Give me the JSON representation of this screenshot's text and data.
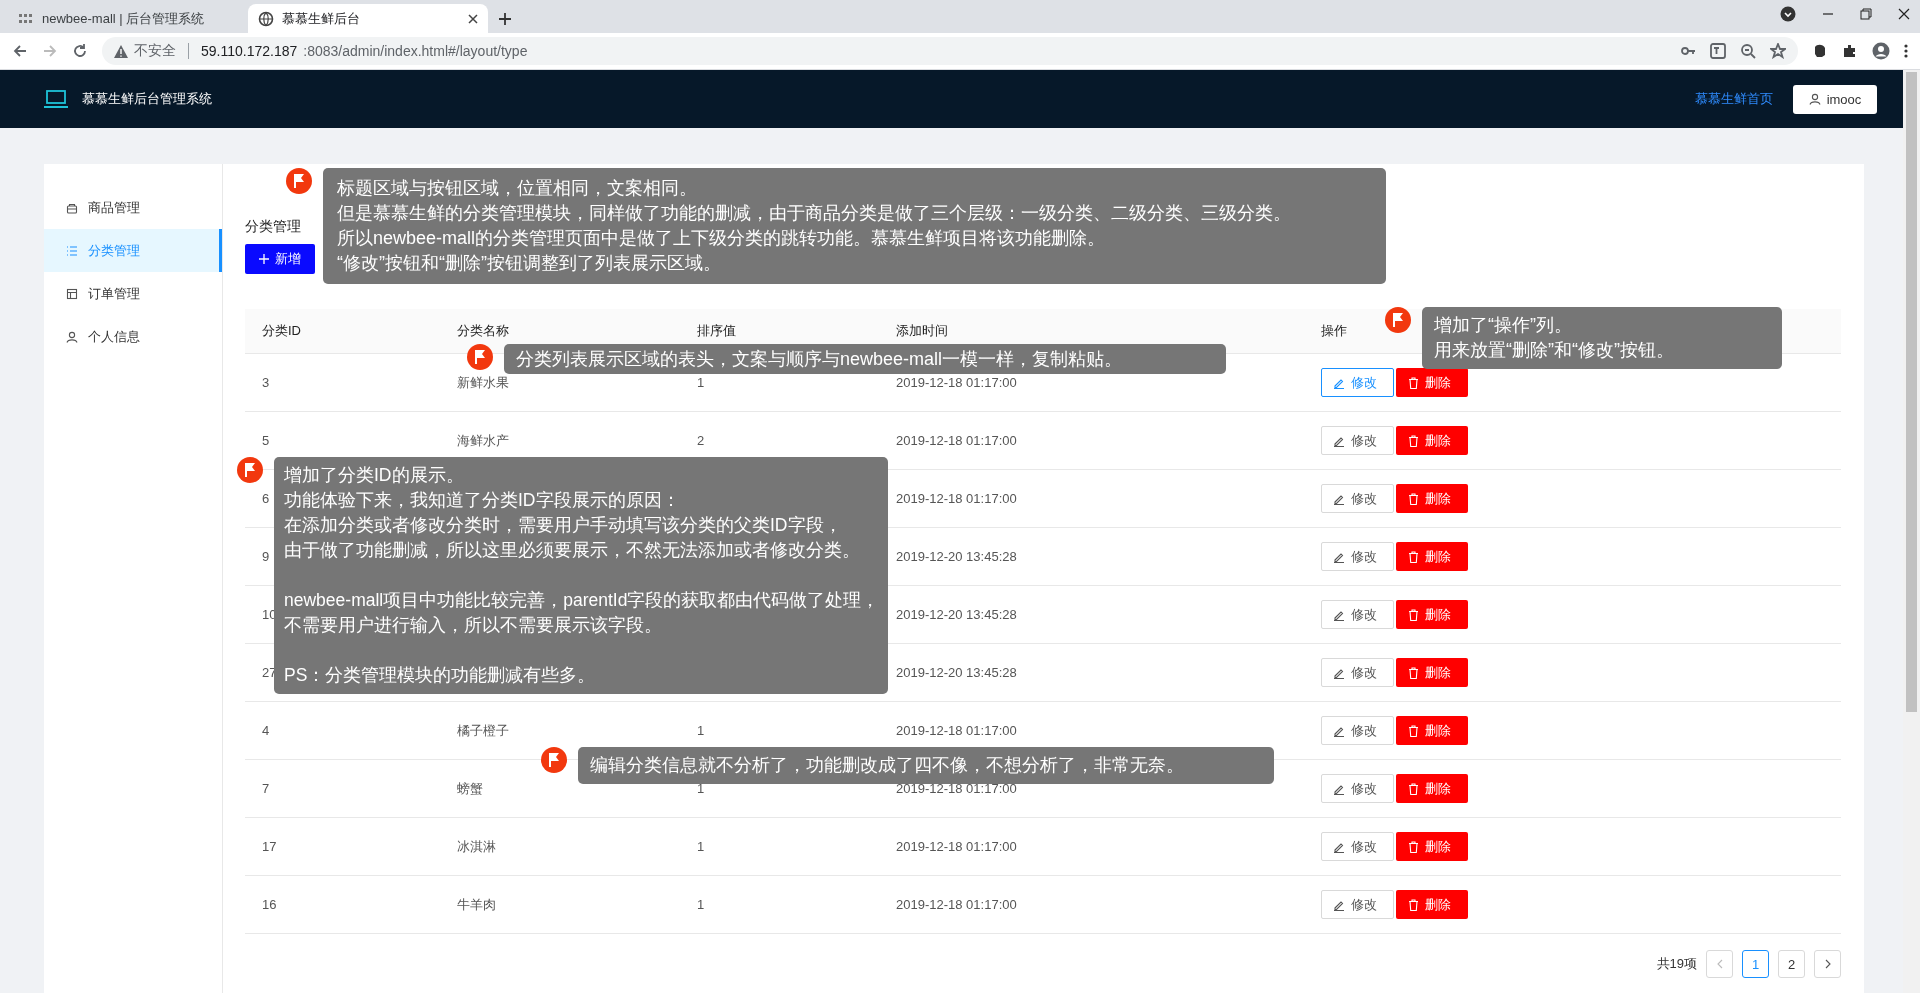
{
  "browser": {
    "tabs": [
      {
        "title": "newbee-mall | 后台管理系统",
        "selected": false
      },
      {
        "title": "慕慕生鲜后台",
        "selected": true
      }
    ],
    "address": {
      "security": "不安全",
      "host": "59.110.172.187",
      "path": ":8083/admin/index.html#/layout/type"
    }
  },
  "header": {
    "title": "慕慕生鲜后台管理系统",
    "home_link": "慕慕生鲜首页",
    "user": "imooc"
  },
  "sidebar": {
    "items": [
      {
        "label": "商品管理",
        "selected": false
      },
      {
        "label": "分类管理",
        "selected": true
      },
      {
        "label": "订单管理",
        "selected": false
      },
      {
        "label": "个人信息",
        "selected": false
      }
    ]
  },
  "page": {
    "title": "分类管理",
    "new_button": "新增"
  },
  "table": {
    "columns": [
      "分类ID",
      "分类名称",
      "排序值",
      "添加时间",
      "操作"
    ],
    "rows": [
      {
        "id": "3",
        "name": "新鲜水果",
        "sort": "1",
        "time": "2019-12-18 01:17:00",
        "edit": "修改",
        "delete": "删除",
        "edit_hovered": true
      },
      {
        "id": "5",
        "name": "海鲜水产",
        "sort": "2",
        "time": "2019-12-18 01:17:00",
        "edit": "修改",
        "delete": "删除",
        "edit_hovered": false
      },
      {
        "id": "6",
        "time": "2019-12-18 01:17:00",
        "edit": "修改",
        "delete": "删除",
        "edit_hovered": false
      },
      {
        "id": "9",
        "time": "2019-12-20 13:45:28",
        "edit": "修改",
        "delete": "删除",
        "edit_hovered": false
      },
      {
        "id": "10",
        "time": "2019-12-20 13:45:28",
        "edit": "修改",
        "delete": "删除",
        "edit_hovered": false
      },
      {
        "id": "27",
        "time": "2019-12-20 13:45:28",
        "edit": "修改",
        "delete": "删除",
        "edit_hovered": false
      },
      {
        "id": "4",
        "name": "橘子橙子",
        "sort": "1",
        "time": "2019-12-18 01:17:00",
        "edit": "修改",
        "delete": "删除",
        "edit_hovered": false
      },
      {
        "id": "7",
        "name": "螃蟹",
        "sort": "1",
        "time": "2019-12-18 01:17:00",
        "edit": "修改",
        "delete": "删除",
        "edit_hovered": false
      },
      {
        "id": "17",
        "name": "冰淇淋",
        "sort": "1",
        "time": "2019-12-18 01:17:00",
        "edit": "修改",
        "delete": "删除",
        "edit_hovered": false
      },
      {
        "id": "16",
        "name": "牛羊肉",
        "sort": "1",
        "time": "2019-12-18 01:17:00",
        "edit": "修改",
        "delete": "删除",
        "edit_hovered": false
      }
    ]
  },
  "pagination": {
    "total": "共19项",
    "pages": [
      {
        "label": "1",
        "selected": true
      },
      {
        "label": "2",
        "selected": false
      }
    ]
  },
  "annotations": [
    {
      "blocks": [
        [
          "标题区域与按钮区域，位置相同，文案相同。",
          "但是慕慕生鲜的分类管理模块，同样做了功能的删减，由于商品分类是做了三个层级：一级分类、二级分类、三级分类。",
          "所以newbee-mall的分类管理页面中是做了上下级分类的跳转功能。慕慕生鲜项目将该功能删除。",
          "“修改”按钮和“删除”按钮调整到了列表展示区域。"
        ]
      ]
    },
    {
      "blocks": [
        [
          "增加了“操作”列。",
          "用来放置“删除”和“修改”按钮。"
        ]
      ]
    },
    {
      "blocks": [
        [
          "分类列表展示区域的表头，文案与顺序与newbee-mall一模一样，复制粘贴。"
        ]
      ]
    },
    {
      "blocks": [
        [
          "增加了分类ID的展示。",
          "功能体验下来，我知道了分类ID字段展示的原因：",
          "在添加分类或者修改分类时，需要用户手动填写该分类的父类ID字段，",
          "由于做了功能删减，所以这里必须要展示，不然无法添加或者修改分类。"
        ],
        [
          "newbee-mall项目中功能比较完善，parentId字段的获取都由代码做了处理，",
          "不需要用户进行输入，所以不需要展示该字段。"
        ],
        [
          "PS：分类管理模块的功能删减有些多。"
        ]
      ]
    },
    {
      "blocks": [
        [
          "编辑分类信息就不分析了，功能删改成了四不像，不想分析了，非常无奈。"
        ]
      ]
    }
  ]
}
